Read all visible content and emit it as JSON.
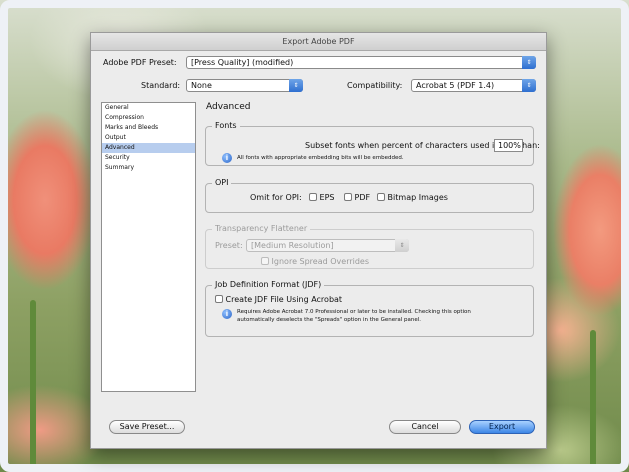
{
  "window": {
    "title": "Export Adobe PDF"
  },
  "preset": {
    "label": "Adobe PDF Preset:",
    "value": "[Press Quality] (modified)"
  },
  "standard": {
    "label": "Standard:",
    "value": "None"
  },
  "compatibility": {
    "label": "Compatibility:",
    "value": "Acrobat 5 (PDF 1.4)"
  },
  "sidebar": {
    "items": [
      {
        "label": "General"
      },
      {
        "label": "Compression"
      },
      {
        "label": "Marks and Bleeds"
      },
      {
        "label": "Output"
      },
      {
        "label": "Advanced"
      },
      {
        "label": "Security"
      },
      {
        "label": "Summary"
      }
    ],
    "selected_index": 4
  },
  "panel": {
    "title": "Advanced"
  },
  "fonts": {
    "title": "Fonts",
    "subset_label": "Subset fonts when percent of characters used is less than:",
    "subset_value": "100%",
    "note": "All fonts with appropriate embedding bits will be embedded."
  },
  "opi": {
    "title": "OPI",
    "omit_label": "Omit for OPI:",
    "options": [
      "EPS",
      "PDF",
      "Bitmap Images"
    ]
  },
  "flattener": {
    "title": "Transparency Flattener",
    "preset_label": "Preset:",
    "preset_value": "[Medium Resolution]",
    "ignore_label": "Ignore Spread Overrides"
  },
  "jdf": {
    "title": "Job Definition Format (JDF)",
    "create_label": "Create JDF File Using Acrobat",
    "note_line1": "Requires Adobe Acrobat 7.0 Professional or later to be installed. Checking this option",
    "note_line2": "automatically deselects the \"Spreads\" option in the General panel."
  },
  "buttons": {
    "save_preset": "Save Preset...",
    "cancel": "Cancel",
    "export": "Export"
  },
  "colors": {
    "accent": "#3d86e6",
    "selection": "#b7cdee",
    "dialog_bg": "#ececec"
  }
}
